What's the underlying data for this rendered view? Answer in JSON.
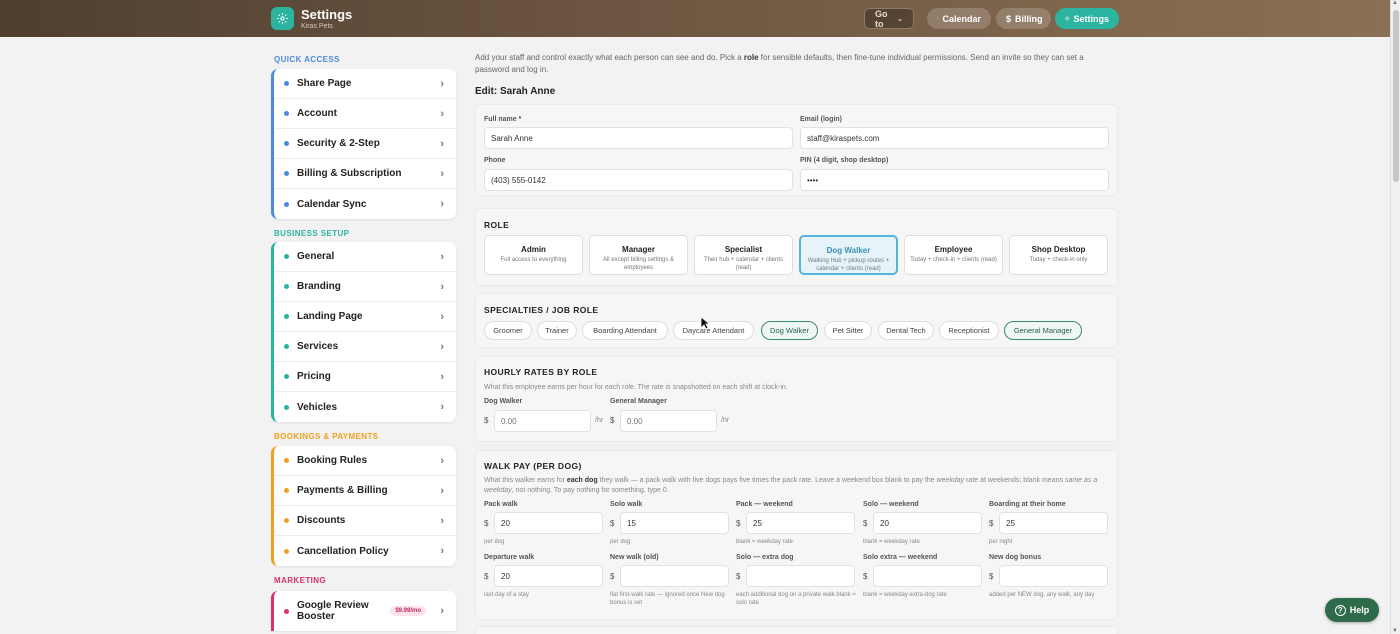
{
  "header": {
    "title": "Settings",
    "subtitle": "Kiras Pets",
    "goto_label": "Go to",
    "calendar_label": "Calendar",
    "billing_label": "Billing",
    "settings_label": "Settings"
  },
  "sidebar": {
    "quick_access": {
      "title": "QUICK ACCESS",
      "color": "#4a8be0",
      "items": [
        {
          "label": "Share Page"
        },
        {
          "label": "Account"
        },
        {
          "label": "Security & 2-Step"
        },
        {
          "label": "Billing & Subscription"
        },
        {
          "label": "Calendar Sync"
        }
      ]
    },
    "business_setup": {
      "title": "BUSINESS SETUP",
      "color": "#2bb5a0",
      "items": [
        {
          "label": "General"
        },
        {
          "label": "Branding"
        },
        {
          "label": "Landing Page"
        },
        {
          "label": "Services"
        },
        {
          "label": "Pricing"
        },
        {
          "label": "Vehicles"
        }
      ]
    },
    "bookings_payments": {
      "title": "BOOKINGS & PAYMENTS",
      "color": "#f0a020",
      "items": [
        {
          "label": "Booking Rules"
        },
        {
          "label": "Payments & Billing"
        },
        {
          "label": "Discounts"
        },
        {
          "label": "Cancellation Policy"
        }
      ]
    },
    "marketing": {
      "title": "MARKETING",
      "color": "#d6336c",
      "items": [
        {
          "label": "Google Review Booster",
          "badge": "$9.99/mo"
        }
      ]
    }
  },
  "main": {
    "intro_a": "Add your staff and control exactly what each person can see and do. Pick a ",
    "intro_b": "role",
    "intro_c": " for sensible defaults, then fine-tune individual permissions. Send an invite so they can set a password and log in.",
    "edit_title": "Edit: Sarah Anne",
    "form": {
      "full_name_label": "Full name *",
      "full_name": "Sarah Anne",
      "email_label": "Email (login)",
      "email": "staff@kiraspets.com",
      "phone_label": "Phone",
      "phone": "(403) 555-0142",
      "pin_label": "PIN (4 digit, shop desktop)",
      "pin": "••••"
    },
    "role_title": "ROLE",
    "roles": [
      {
        "name": "Admin",
        "desc": "Full access to everything"
      },
      {
        "name": "Manager",
        "desc": "All except billing settings & employees"
      },
      {
        "name": "Specialist",
        "desc": "Their hub + calendar + clients (read)"
      },
      {
        "name": "Dog Walker",
        "desc": "Walking Hub + pickup routes + calendar + clients (read)",
        "selected": true
      },
      {
        "name": "Employee",
        "desc": "Today + check-in + clients (read)"
      },
      {
        "name": "Shop Desktop",
        "desc": "Today + check-in only"
      }
    ],
    "specialties_title": "SPECIALTIES / JOB ROLE",
    "specialties": [
      {
        "label": "Groomer"
      },
      {
        "label": "Trainer"
      },
      {
        "label": "Boarding Attendant"
      },
      {
        "label": "Daycare Attendant"
      },
      {
        "label": "Dog Walker",
        "active": true
      },
      {
        "label": "Pet Sitter"
      },
      {
        "label": "Dental Tech"
      },
      {
        "label": "Receptionist"
      },
      {
        "label": "General Manager",
        "active": true
      }
    ],
    "hourly": {
      "title": "HOURLY RATES BY ROLE",
      "desc": "What this employee earns per hour for each role. The rate is snapshotted on each shift at clock-in.",
      "currency": "$",
      "unit": "/hr",
      "rates": [
        {
          "label": "Dog Walker",
          "placeholder": "0.00"
        },
        {
          "label": "General Manager",
          "placeholder": "0.00"
        }
      ]
    },
    "walk_pay": {
      "title": "WALK PAY (PER DOG)",
      "desc_a": "What this walker earns for ",
      "desc_b": "each dog",
      "desc_c": " they walk — a pack walk with five dogs pays five times the pack rate. Leave a weekend box blank to pay the ",
      "desc_d": "weekday",
      "desc_e": " rate at weekends; blank means ",
      "desc_f": "same as a weekday",
      "desc_g": ", not nothing. To pay nothing for something, type 0.",
      "currency": "$",
      "row1": [
        {
          "label": "Pack walk",
          "value": "20",
          "hint": "per dog"
        },
        {
          "label": "Solo walk",
          "value": "15",
          "hint": "per dog"
        },
        {
          "label": "Pack — weekend",
          "value": "25",
          "hint": "blank = weekday rate"
        },
        {
          "label": "Solo — weekend",
          "value": "20",
          "hint": "blank = weekday rate"
        },
        {
          "label": "Boarding at their home",
          "value": "25",
          "hint": "per night"
        }
      ],
      "row2": [
        {
          "label": "Departure walk",
          "value": "20",
          "hint": "last day of a stay"
        },
        {
          "label": "New walk (old)",
          "value": "",
          "hint": "flat first-walk rate — ignored once New dog bonus is set"
        },
        {
          "label": "Solo — extra dog",
          "value": "",
          "hint": "each additional dog on a private walk blank = solo rate"
        },
        {
          "label": "Solo extra — weekend",
          "value": "",
          "hint": "blank = weekday extra-dog rate"
        },
        {
          "label": "New dog bonus",
          "value": "",
          "hint": "added per NEW dog, any walk, any day"
        }
      ]
    }
  },
  "help_label": "Help",
  "icons": {
    "logo": "gear-icon",
    "calendar": "calendar-icon",
    "billing": "dollar-icon",
    "settings": "gear-icon",
    "goto": "chevron-down-icon",
    "nav": "chevron-right-icon",
    "help": "question-icon"
  }
}
